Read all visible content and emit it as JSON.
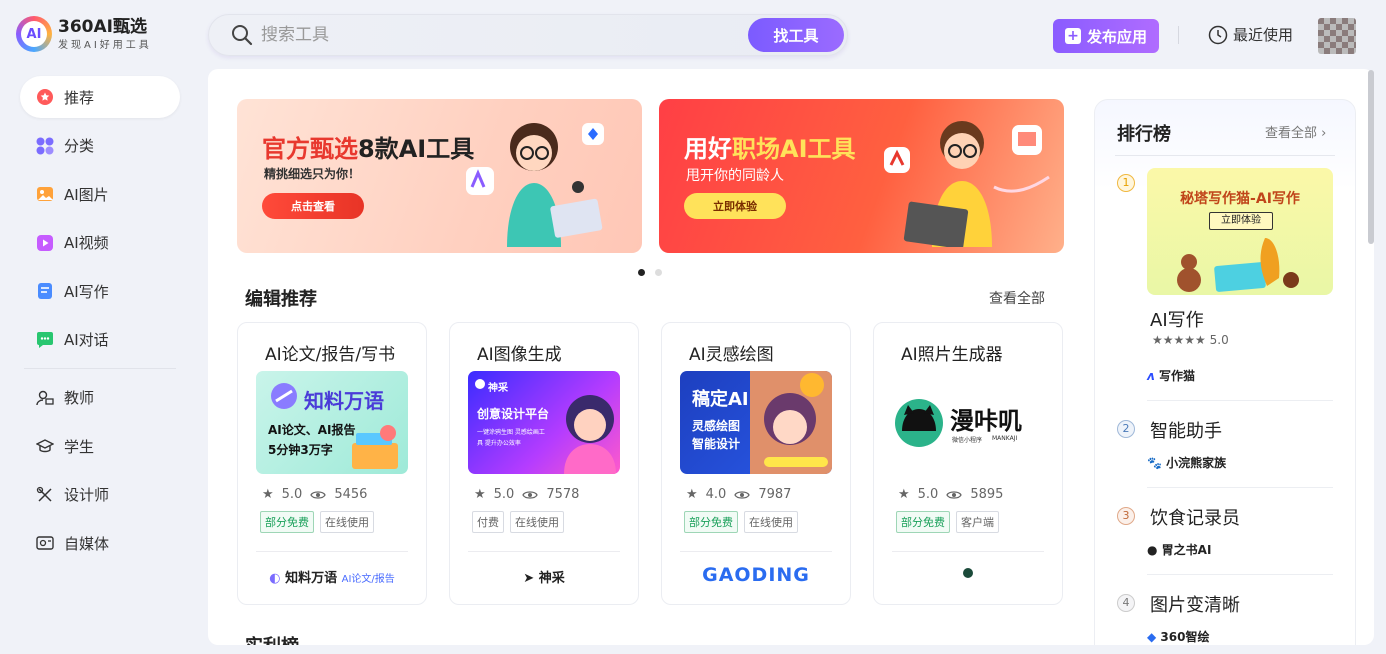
{
  "brand": {
    "name": "360AI甄选",
    "tagline": "发现AI好用工具",
    "badge": "AI"
  },
  "search": {
    "placeholder": "搜索工具",
    "button": "找工具"
  },
  "header": {
    "publish": "发布应用",
    "recent": "最近使用"
  },
  "sidebar": {
    "items": [
      {
        "label": "推荐",
        "icon": "star-icon"
      },
      {
        "label": "分类",
        "icon": "grid-icon"
      },
      {
        "label": "AI图片",
        "icon": "image-icon"
      },
      {
        "label": "AI视频",
        "icon": "video-icon"
      },
      {
        "label": "AI写作",
        "icon": "document-icon"
      },
      {
        "label": "AI对话",
        "icon": "chat-icon"
      }
    ],
    "audiences": [
      {
        "label": "教师",
        "icon": "teacher-icon"
      },
      {
        "label": "学生",
        "icon": "graduation-cap-icon"
      },
      {
        "label": "设计师",
        "icon": "design-tools-icon"
      },
      {
        "label": "自媒体",
        "icon": "media-icon"
      }
    ]
  },
  "banners": [
    {
      "title_a": "官方甄选",
      "title_b": "8款AI工具",
      "subtitle": "精挑细选只为你！",
      "button": "点击查看"
    },
    {
      "title_a": "用好",
      "title_b": "职场AI工具",
      "subtitle": "甩开你的同龄人",
      "button": "立即体验"
    }
  ],
  "editor_section": {
    "title": "编辑推荐",
    "more": "查看全部"
  },
  "cards": [
    {
      "category": "AI论文/报告/写书",
      "rating": "5.0",
      "views": "5456",
      "tags": [
        "部分免费",
        "在线使用"
      ],
      "brand": "知料万语",
      "brand_sub": "AI论文/报告",
      "image": {
        "name": "知料万语",
        "line1": "AI论文、AI报告",
        "line2": "5分钟3万字"
      }
    },
    {
      "category": "AI图像生成",
      "rating": "5.0",
      "views": "7578",
      "tags": [
        "付费",
        "在线使用"
      ],
      "brand": "神采",
      "brand_sub": "",
      "image": {
        "name": "神采",
        "line1": "创意设计平台",
        "line2": "一键涂鸦生图 灵感绘画工具 提升办公效率"
      }
    },
    {
      "category": "AI灵感绘图",
      "rating": "4.0",
      "views": "7987",
      "tags": [
        "部分免费",
        "在线使用"
      ],
      "brand": "GAODING",
      "brand_sub": "",
      "image": {
        "name": "稿定AI",
        "line1": "灵感绘图",
        "line2": "智能设计"
      }
    },
    {
      "category": "AI照片生成器",
      "rating": "5.0",
      "views": "5895",
      "tags": [
        "部分免费",
        "客户端"
      ],
      "brand": "漫咔叽",
      "brand_sub": "",
      "image": {
        "name": "漫咔叽",
        "line1": "微信小程序",
        "line2": "MANKAJI"
      }
    }
  ],
  "next_section": {
    "title": "实利榜"
  },
  "ranking": {
    "title": "排行榜",
    "more": "查看全部",
    "featured": {
      "rank": "1",
      "banner_title": "秘塔写作猫-AI写作",
      "banner_button": "立即体验",
      "name": "AI写作",
      "stars": "★★★★★",
      "rating": "5.0",
      "brand": "写作猫"
    },
    "items": [
      {
        "rank": "2",
        "name": "智能助手",
        "brand": "小浣熊家族"
      },
      {
        "rank": "3",
        "name": "饮食记录员",
        "brand": "胃之书AI"
      },
      {
        "rank": "4",
        "name": "图片变清晰",
        "brand": "360智绘"
      }
    ]
  },
  "colors": {
    "accent": "#7b5bff",
    "red": "#e8382e",
    "free_green": "#1aa05a"
  }
}
